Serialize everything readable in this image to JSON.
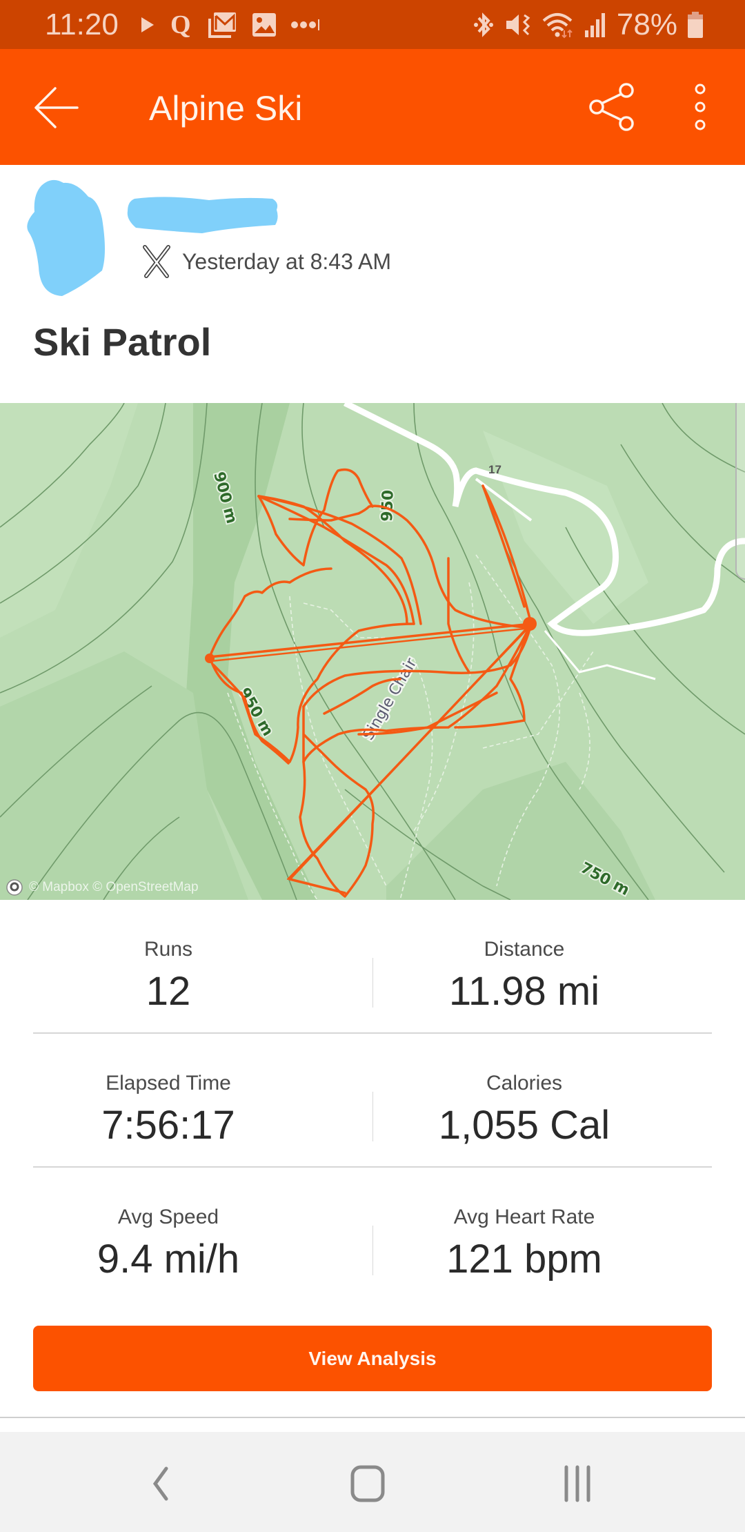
{
  "status_bar": {
    "time": "11:20",
    "left_icons": [
      "play-store-icon",
      "quora-icon",
      "gmail-icon",
      "gallery-icon",
      "more-notifications-icon"
    ],
    "right_icons": [
      "bluetooth-icon",
      "mute-vibrate-icon",
      "wifi-icon",
      "signal-icon"
    ],
    "battery_percent": "78%"
  },
  "app_bar": {
    "title": "Alpine Ski",
    "back_icon": "arrow-left-icon",
    "share_icon": "share-icon",
    "more_icon": "more-vertical-icon"
  },
  "activity": {
    "athlete_name": "[redacted]",
    "sport_icon": "alpine-ski-icon",
    "timestamp": "Yesterday at 8:43 AM",
    "title": "Ski Patrol"
  },
  "map": {
    "contour_labels": [
      "900 m",
      "950 m",
      "950 m",
      "750 m"
    ],
    "lift_label": "Single Chair",
    "road_label": "17",
    "attribution": "© Mapbox © OpenStreetMap",
    "route_color": "#f45a14"
  },
  "stats": [
    [
      {
        "label": "Runs",
        "value": "12"
      },
      {
        "label": "Distance",
        "value": "11.98 mi"
      }
    ],
    [
      {
        "label": "Elapsed Time",
        "value": "7:56:17"
      },
      {
        "label": "Calories",
        "value": "1,055 Cal"
      }
    ],
    [
      {
        "label": "Avg Speed",
        "value": "9.4 mi/h"
      },
      {
        "label": "Avg Heart Rate",
        "value": "121 bpm"
      }
    ]
  ],
  "cta": {
    "label": "View Analysis"
  },
  "nav_bar": {
    "back": "nav-back-icon",
    "home": "nav-home-icon",
    "recents": "nav-recents-icon"
  },
  "colors": {
    "brand": "#fc5200",
    "status_bar": "#cc4400",
    "map_green": "#bcdcb4"
  }
}
